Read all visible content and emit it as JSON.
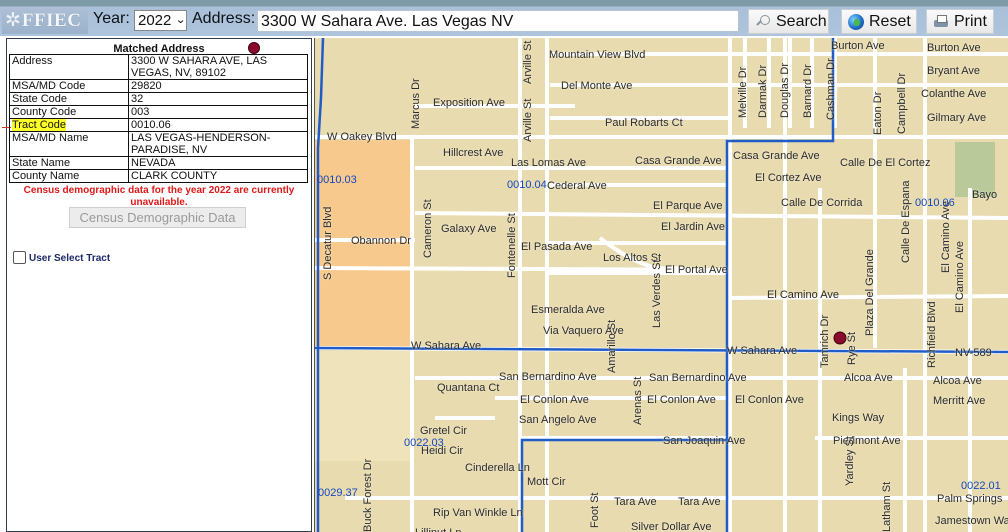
{
  "header": {
    "logo_text": "FFIEC",
    "logo_icon": "star-icon",
    "year_label": "Year:",
    "year_value": "2022",
    "address_label": "Address:",
    "address_value": "3300 W Sahara Ave. Las Vegas NV",
    "buttons": {
      "search": {
        "label": "Search",
        "icon": "magnifier-icon"
      },
      "reset": {
        "label": "Reset",
        "icon": "globe-icon"
      },
      "print": {
        "label": "Print",
        "icon": "printer-icon"
      }
    }
  },
  "panel": {
    "title": "Matched Address",
    "rows": [
      {
        "key": "Address",
        "value": "3300 W SAHARA AVE, LAS VEGAS, NV, 89102"
      },
      {
        "key": "MSA/MD Code",
        "value": "29820"
      },
      {
        "key": "State Code",
        "value": "32"
      },
      {
        "key": "County Code",
        "value": "003"
      },
      {
        "key": "Tract Code",
        "value": "0010.06",
        "highlighted": true
      },
      {
        "key": "MSA/MD Name",
        "value": "LAS VEGAS-HENDERSON-PARADISE, NV"
      },
      {
        "key": "State Name",
        "value": "NEVADA"
      },
      {
        "key": "County Name",
        "value": "CLARK COUNTY"
      }
    ],
    "census_message": "Census demographic data for the year 2022 are currently unavailable.",
    "census_button": "Census Demographic Data",
    "user_select_tract": {
      "label": "User Select Tract",
      "checked": false
    }
  },
  "map": {
    "colors": {
      "background": "#e8dbb0",
      "road": "#ffffff",
      "tract_boundary": "#1f5cc8",
      "highlight_area": "#f7c98d",
      "marker": "#8b0a2e",
      "park": "#b9c99a"
    },
    "tract_labels": [
      "0010.03",
      "0010.04",
      "0010.06",
      "0022.03",
      "0029.37",
      "0022.01"
    ],
    "street_labels": [
      "Mountain View Blvd",
      "Del Monte Ave",
      "Exposition Ave",
      "Paul Robarts Ct",
      "W Oakey Blvd",
      "Marcus Dr",
      "Arville St",
      "Arville St",
      "Hillcrest Ave",
      "Las Lomas Ave",
      "Casa Grande Ave",
      "Casa Grande Ave",
      "Cederal Ave",
      "Calle De El Cortez",
      "El Cortez Ave",
      "Calle De Corrida",
      "El Parque Ave",
      "El Jardin Ave",
      "Galaxy Ave",
      "Obannon Dr",
      "El Pasada Ave",
      "Los Altos St",
      "El Portal Ave",
      "El Camino Ave",
      "Esmeralda Ave",
      "Via Vaquero Ave",
      "W Sahara Ave",
      "W Sahara Ave",
      "NV-589",
      "Cameron St",
      "S Decatur Blvd",
      "Fontenelle St",
      "Las Verdes St",
      "Burton Ave",
      "Burton Ave",
      "Bryant Ave",
      "Colanthe Ave",
      "Gilmary Ave",
      "Melville Dr",
      "Darmak Dr",
      "Douglas Dr",
      "Barnard Dr",
      "Cashman Dr",
      "Eaton Dr",
      "Campbell Dr",
      "Plaza Del Grande",
      "Calle De Espana",
      "El Camino Ave",
      "El Camino Ave",
      "Richfield Blvd",
      "Tamrich Dr",
      "Rye St",
      "Bayo",
      "Quantana Ct",
      "San Bernardino Ave",
      "San Bernardino Ave",
      "El Conlon Ave",
      "El Conlon Ave",
      "El Conlon Ave",
      "San Angelo Ave",
      "Amarillo St",
      "Arenas St",
      "San Joaquin Ave",
      "Alcoa Ave",
      "Alcoa Ave",
      "Merritt Ave",
      "Kings Way",
      "Piedmont Ave",
      "Yardley St",
      "Gretel Cir",
      "Heidi Cir",
      "Cinderella Ln",
      "Mott Cir",
      "Rip Van Winkle Ln",
      "Tara Ave",
      "Tara Ave",
      "Silver Dollar Ave",
      "Buck Forest Dr",
      "Palm Springs",
      "Jamestown Way",
      "Lilliput Ln",
      "Foot St",
      "Latham St"
    ]
  }
}
